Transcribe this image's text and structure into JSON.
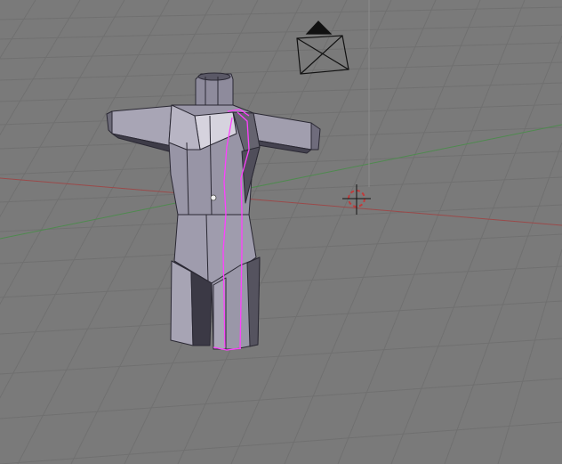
{
  "viewport": {
    "name": "3D Viewport",
    "background_color": "#7a7a7a",
    "grid_color": "#6e6e6e",
    "x_axis_color": "#9a4a4a",
    "y_axis_color": "#4f8a4f",
    "z_axis_color": "#8a8a8a"
  },
  "scene": {
    "mesh": {
      "name": "body-mesh",
      "mode": "edit",
      "selection_color": "#ff3fff",
      "face_light": "#b9b6c4",
      "face_mid": "#9a97a8",
      "face_dark": "#4f4d5a"
    },
    "camera": {
      "icon": "camera-icon"
    },
    "cursor": {
      "icon": "3d-cursor-icon",
      "ring_color": "#c23a3a"
    }
  }
}
